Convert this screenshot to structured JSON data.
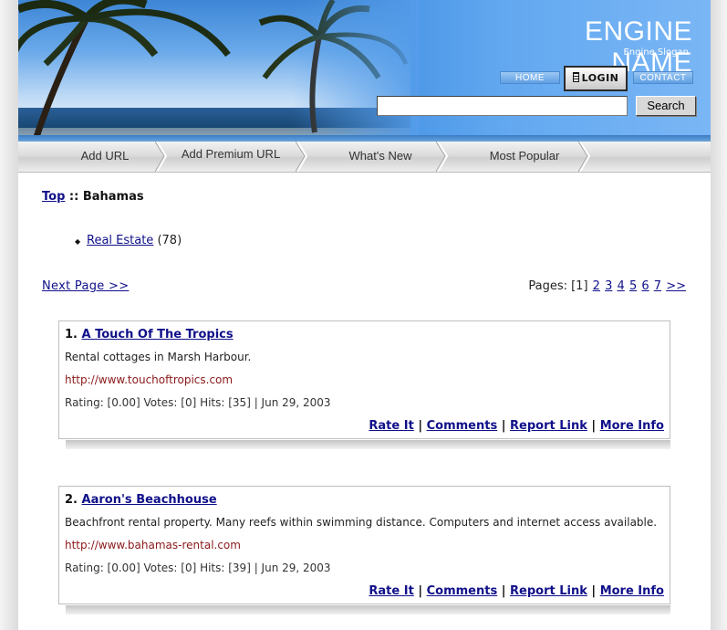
{
  "header": {
    "engine_name": "ENGINE NAME",
    "slogan": "Engine Slogan",
    "home_label": "HOME",
    "login_label": "LOGIN",
    "contact_label": "CONTACT",
    "search_value": "",
    "search_button": "Search"
  },
  "nav": {
    "tabs": [
      {
        "label": "Add URL"
      },
      {
        "label": "Add Premium URL"
      },
      {
        "label": "What's New"
      },
      {
        "label": "Most Popular"
      }
    ]
  },
  "breadcrumb": {
    "top_label": "Top",
    "separator": " :: ",
    "current": "Bahamas"
  },
  "categories": [
    {
      "name": "Real Estate",
      "count": "(78)"
    }
  ],
  "pagination": {
    "next_label": "Next Page >>",
    "pages_label": "Pages:",
    "current": "[1]",
    "pages": [
      "2",
      "3",
      "4",
      "5",
      "6",
      "7"
    ],
    "more": ">>"
  },
  "listings": [
    {
      "number": "1.",
      "title": "A Touch Of The Tropics",
      "description": "Rental cottages in Marsh Harbour.",
      "url": "http://www.touchoftropics.com",
      "stats": "Rating: [0.00] Votes: [0] Hits: [35] | Jun 29, 2003"
    },
    {
      "number": "2.",
      "title": "Aaron's Beachhouse",
      "description": "Beachfront rental property. Many reefs within swimming distance. Computers and internet access available.",
      "url": "http://www.bahamas-rental.com",
      "stats": "Rating: [0.00] Votes: [0] Hits: [39] | Jun 29, 2003"
    }
  ],
  "actions": {
    "rate": "Rate It",
    "comments": "Comments",
    "report": "Report Link",
    "more": "More Info",
    "sep": " | "
  },
  "colors": {
    "link": "#10108a",
    "url": "#8b1a1a",
    "header_blue": "#3a8ae0"
  }
}
